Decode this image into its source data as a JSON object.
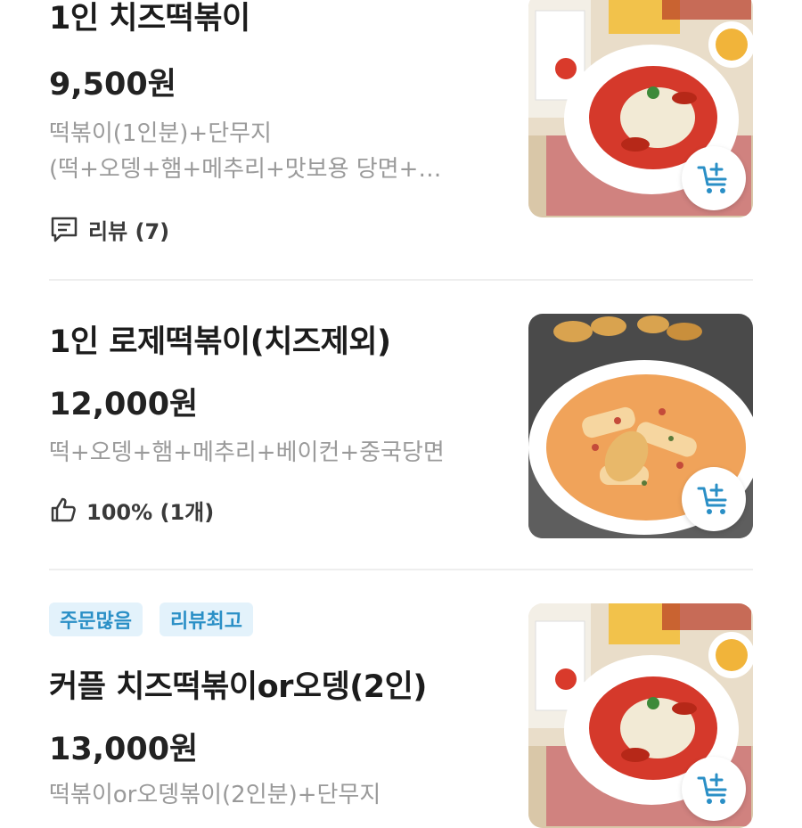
{
  "menu": [
    {
      "name": "1인 치즈떡볶이",
      "price": "9,500원",
      "desc_line1": "떡볶이(1인분)+단무지",
      "desc_line2": "(떡+오뎅+햄+메추리+맛보용 당면+…",
      "meta_text": "리뷰 (7)",
      "meta_icon": "review-icon"
    },
    {
      "name": "1인 로제떡볶이(치즈제외)",
      "price": "12,000원",
      "desc_line1": "떡+오뎅+햄+메추리+베이컨+중국당면",
      "meta_text": "100% (1개)",
      "meta_icon": "thumbs-up-icon"
    },
    {
      "tags": [
        "주문많음",
        "리뷰최고"
      ],
      "name": "커플 치즈떡볶이or오뎅(2인)",
      "price": "13,000원",
      "desc_line1": "떡볶이or오뎅볶이(2인분)+단무지"
    }
  ],
  "colors": {
    "cart_icon": "#2a8fc6",
    "tag_bg": "#e3f2fb",
    "tag_text": "#2a8fc6"
  }
}
